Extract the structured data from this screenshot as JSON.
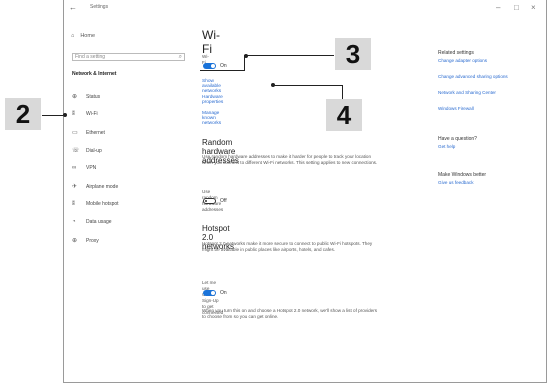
{
  "window": {
    "title": "Settings",
    "controls": [
      "–",
      "□",
      "×"
    ]
  },
  "sidebar": {
    "home": "Home",
    "search_placeholder": "Find a setting",
    "section": "Network & Internet",
    "items": [
      {
        "label": "Status",
        "icon": "globe-icon"
      },
      {
        "label": "Wi-Fi",
        "icon": "wifi-icon"
      },
      {
        "label": "Ethernet",
        "icon": "ethernet-icon"
      },
      {
        "label": "Dial-up",
        "icon": "dialup-icon"
      },
      {
        "label": "VPN",
        "icon": "vpn-icon"
      },
      {
        "label": "Airplane mode",
        "icon": "airplane-icon"
      },
      {
        "label": "Mobile hotspot",
        "icon": "hotspot-icon"
      },
      {
        "label": "Data usage",
        "icon": "data-usage-icon"
      },
      {
        "label": "Proxy",
        "icon": "globe-icon"
      }
    ]
  },
  "main": {
    "title": "Wi-Fi",
    "wifi_label": "Wi-Fi",
    "wifi_state": "On",
    "links": [
      "Show available networks",
      "Hardware properties",
      "Manage known networks"
    ],
    "random_title": "Random hardware addresses",
    "random_desc": "Use random hardware addresses to make it harder for people to track your location when you connect to different Wi-Fi networks. This setting applies to new connections.",
    "random_toggle_label": "Use random hardware addresses",
    "random_state": "Off",
    "hotspot_title": "Hotspot 2.0 networks",
    "hotspot_desc": "Hotspot 2.0 networks make it more secure to connect to public Wi-Fi hotspots. They might be available in public places like airports, hotels, and cafes.",
    "signup_label": "Let me use Online Sign-Up to get connected",
    "signup_state": "On",
    "footer_desc": "When you turn this on and choose a Hotspot 2.0 network, we'll show a list of providers to choose from so you can get online."
  },
  "related": {
    "heading": "Related settings",
    "links": [
      "Change adapter options",
      "Change advanced sharing options",
      "Network and Sharing Center",
      "Windows Firewall"
    ],
    "question": "Have a question?",
    "help": "Get help",
    "better": "Make Windows better",
    "feedback": "Give us feedback"
  },
  "callouts": [
    "2",
    "3",
    "4"
  ]
}
